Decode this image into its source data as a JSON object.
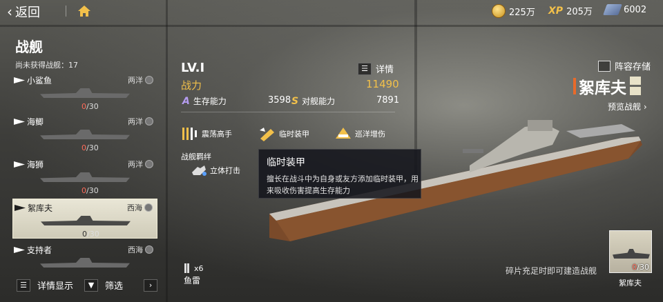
{
  "topbar": {
    "back_label": "返回",
    "resources": [
      {
        "icon": "gold-coin-icon",
        "value": "225万"
      },
      {
        "icon": "xp-icon",
        "label": "XP",
        "value": "205万"
      },
      {
        "icon": "steel-icon",
        "value": "6002"
      }
    ]
  },
  "left": {
    "title": "战舰",
    "unowned": "尚未获得战舰：17",
    "ships": [
      {
        "name": "小鲨鱼",
        "sea": "两洋",
        "owned": "0",
        "total": "/30"
      },
      {
        "name": "海鲫",
        "sea": "两洋",
        "owned": "0",
        "total": "/30"
      },
      {
        "name": "海狮",
        "sea": "两洋",
        "owned": "0",
        "total": "/30"
      },
      {
        "name": "絮库夫",
        "sea": "西海",
        "owned": "0",
        "total": "/30"
      },
      {
        "name": "支持者",
        "sea": "西海",
        "owned": "",
        "total": ""
      }
    ],
    "detail_display": "详情显示",
    "filter": "筛选"
  },
  "info": {
    "level": "LV.I",
    "detail": "详情",
    "power_label": "战力",
    "power_value": "11490",
    "survive_letter": "A",
    "survive_label": "生存能力",
    "survive_value": "3598",
    "anti_letter": "S",
    "anti_label": "对舰能力",
    "anti_value": "7891",
    "skills": [
      "震荡高手",
      "临时装甲",
      "巡洋增伤"
    ],
    "bond_title": "战舰羁绊",
    "bond": "立体打击"
  },
  "tooltip": {
    "title": "临时装甲",
    "body": "擅长在战斗中为自身或友方添加临时装甲，用来吸收伤害提高生存能力"
  },
  "right": {
    "lineup": "阵容存储",
    "ship_name": "絮库夫",
    "preview": "预览战舰",
    "build_hint": "碎片充足时即可建造战舰",
    "thumb_owned": "0",
    "thumb_total": "/30",
    "thumb_label": "絮库夫"
  },
  "weapon": {
    "count": "x6",
    "label": "鱼雷"
  },
  "colors": {
    "gold": "#f2c04a",
    "red": "#ff6b5a",
    "accent": "#e86a2a"
  }
}
